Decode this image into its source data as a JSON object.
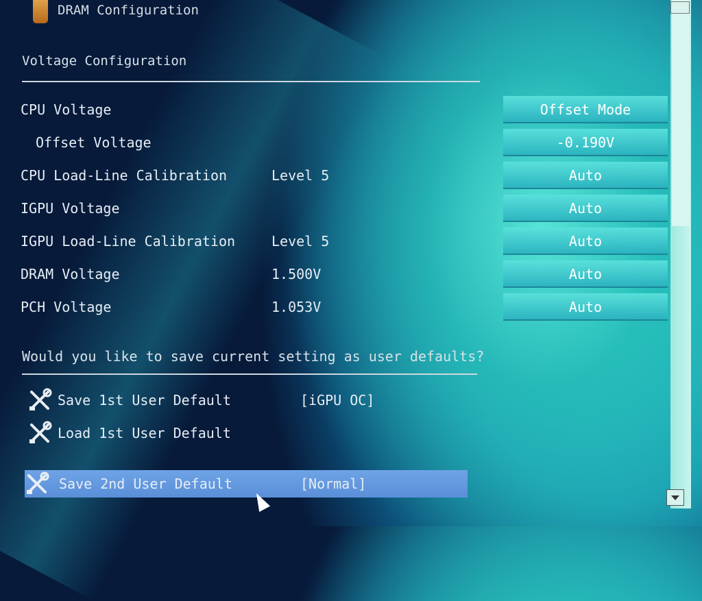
{
  "header": {
    "title": "DRAM Configuration"
  },
  "voltage_section": {
    "title": "Voltage Configuration",
    "rows": [
      {
        "label": "CPU Voltage",
        "info": "",
        "value": "Offset Mode"
      },
      {
        "label": "Offset Voltage",
        "info": "",
        "value": "-0.190V"
      },
      {
        "label": "CPU Load-Line Calibration",
        "info": "Level 5",
        "value": "Auto"
      },
      {
        "label": "IGPU Voltage",
        "info": "",
        "value": "Auto"
      },
      {
        "label": "IGPU Load-Line Calibration",
        "info": "Level 5",
        "value": "Auto"
      },
      {
        "label": "DRAM Voltage",
        "info": "1.500V",
        "value": "Auto"
      },
      {
        "label": "PCH Voltage",
        "info": "1.053V",
        "value": "Auto"
      }
    ]
  },
  "user_defaults": {
    "prompt": "Would you like to save current setting as user defaults?",
    "items": [
      {
        "label": "Save 1st User Default",
        "tag": "[iGPU OC]"
      },
      {
        "label": "Load 1st User Default",
        "tag": ""
      },
      {
        "label": "Save 2nd User Default",
        "tag": "[Normal]"
      }
    ]
  },
  "icons": {
    "header": "dram-config-icon",
    "item": "wrench-screwdriver-icon",
    "scroll_up": "scroll-up-icon",
    "scroll_down": "scroll-down-icon",
    "cursor": "mouse-cursor-icon"
  },
  "colors": {
    "selected_row": "#6fa3e6",
    "value_box": "#3fc9cb",
    "text": "#e6eef5"
  }
}
